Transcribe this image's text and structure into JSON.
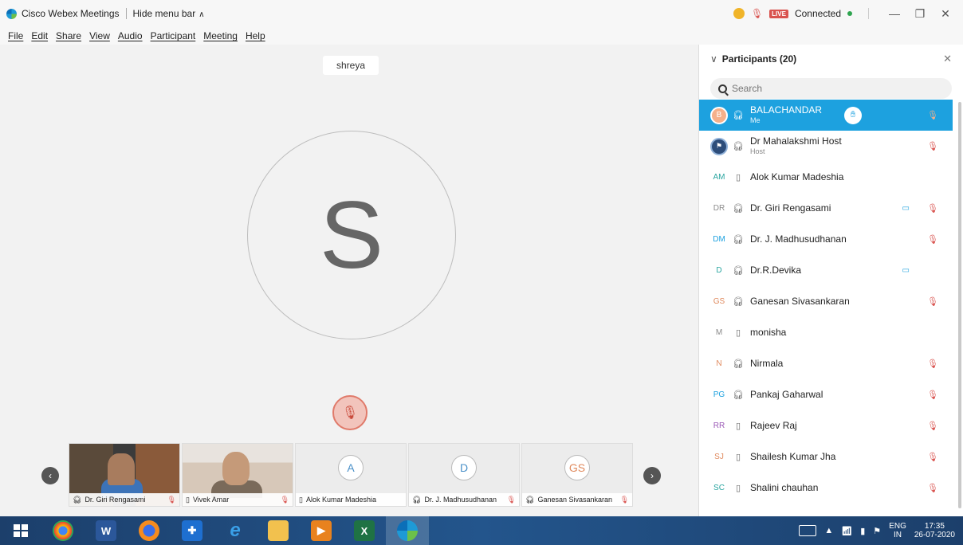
{
  "titlebar": {
    "app_title": "Cisco Webex Meetings",
    "hide_menu": "Hide menu bar",
    "live_label": "LIVE",
    "connection_status": "Connected"
  },
  "menu": [
    "File",
    "Edit",
    "Share",
    "View",
    "Audio",
    "Participant",
    "Meeting",
    "Help"
  ],
  "stage": {
    "active_speaker_name": "shreya",
    "avatar_letter": "S"
  },
  "thumbnails": [
    {
      "name": "Dr. Giri Rengasami",
      "type": "video",
      "muted": true
    },
    {
      "name": "Vivek Amar",
      "type": "video",
      "muted": true
    },
    {
      "name": "Alok Kumar Madeshia",
      "type": "avatar",
      "initial": "A",
      "muted": false
    },
    {
      "name": "Dr. J. Madhusudhanan",
      "type": "avatar",
      "initial": "D",
      "muted": true
    },
    {
      "name": "Ganesan Sivasankaran",
      "type": "avatar",
      "initial": "GS",
      "muted": true
    }
  ],
  "participants_panel": {
    "title": "Participants (20)",
    "search_placeholder": "Search",
    "items": [
      {
        "initials": "B",
        "name": "BALACHANDAR",
        "sub": "Me",
        "device": "headset",
        "muted": true,
        "camera": false,
        "selected": true,
        "raised_hand": true,
        "color": "#f5b08a"
      },
      {
        "initials": "",
        "name": "Dr Mahalakshmi Host",
        "sub": "Host",
        "device": "headset",
        "muted": true,
        "camera": false,
        "avatar": "host-photo"
      },
      {
        "initials": "AM",
        "name": "Alok Kumar Madeshia",
        "sub": "",
        "device": "phone",
        "muted": false,
        "camera": false,
        "color": "#2aa5a0"
      },
      {
        "initials": "DR",
        "name": "Dr. Giri Rengasami",
        "sub": "",
        "device": "headset",
        "muted": true,
        "camera": true,
        "color": "#8a8a8a"
      },
      {
        "initials": "DM",
        "name": "Dr. J. Madhusudhanan",
        "sub": "",
        "device": "headset",
        "muted": true,
        "camera": false,
        "color": "#1da1df"
      },
      {
        "initials": "D",
        "name": "Dr.R.Devika",
        "sub": "",
        "device": "headset",
        "muted": false,
        "camera": true,
        "color": "#2aa5a0"
      },
      {
        "initials": "GS",
        "name": "Ganesan Sivasankaran",
        "sub": "",
        "device": "headset",
        "muted": true,
        "camera": false,
        "color": "#e08a5e"
      },
      {
        "initials": "M",
        "name": "monisha",
        "sub": "",
        "device": "phone",
        "muted": false,
        "camera": false,
        "color": "#8a8a8a"
      },
      {
        "initials": "N",
        "name": "Nirmala",
        "sub": "",
        "device": "headset",
        "muted": true,
        "camera": false,
        "color": "#e08a5e"
      },
      {
        "initials": "PG",
        "name": "Pankaj Gaharwal",
        "sub": "",
        "device": "headset",
        "muted": true,
        "camera": false,
        "color": "#1da1df"
      },
      {
        "initials": "RR",
        "name": "Rajeev Raj",
        "sub": "",
        "device": "phone",
        "muted": true,
        "camera": false,
        "color": "#9b59b6"
      },
      {
        "initials": "SJ",
        "name": "Shailesh Kumar Jha",
        "sub": "",
        "device": "phone",
        "muted": true,
        "camera": false,
        "color": "#e08a5e"
      },
      {
        "initials": "SC",
        "name": "Shalini chauhan",
        "sub": "",
        "device": "phone",
        "muted": true,
        "camera": false,
        "color": "#2aa5a0"
      }
    ]
  },
  "taskbar": {
    "apps": [
      "chrome",
      "word",
      "firefox",
      "defender",
      "internet-explorer",
      "file-explorer",
      "media-player",
      "excel",
      "webex"
    ],
    "language_top": "ENG",
    "language_bottom": "IN",
    "time": "17:35",
    "date": "26-07-2020"
  }
}
